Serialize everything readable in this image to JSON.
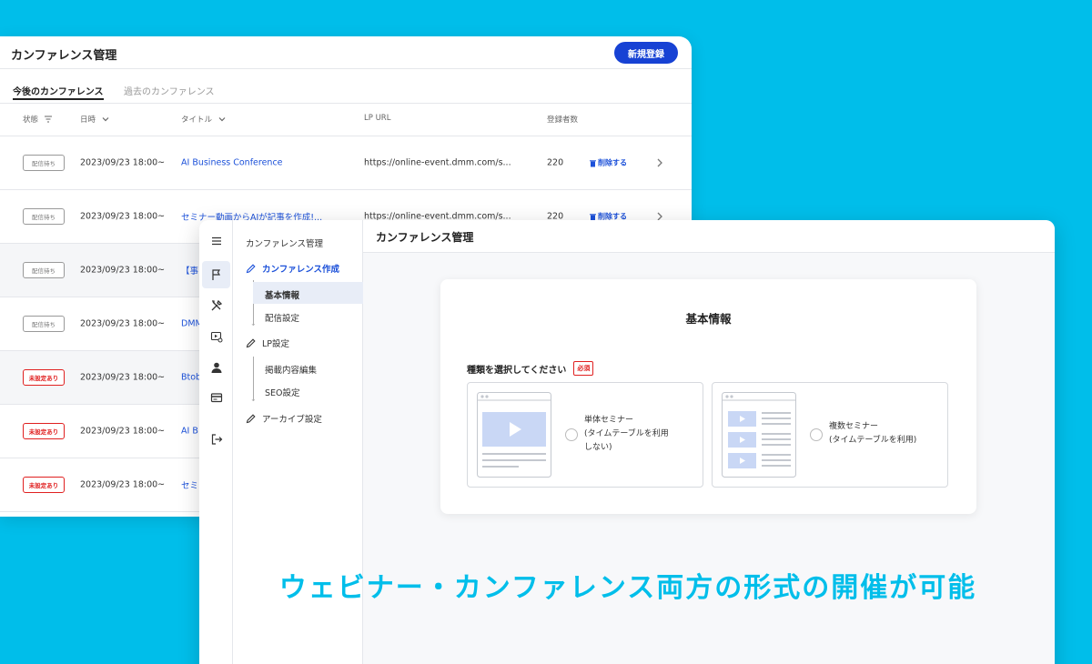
{
  "colors": {
    "background": "#00BEEA",
    "accent": "#1742D4",
    "link": "#1b50d9",
    "danger": "#E02020"
  },
  "back_window": {
    "title": "カンファレンス管理",
    "new_button": "新規登録",
    "tabs": [
      {
        "label": "今後のカンファレンス",
        "active": true
      },
      {
        "label": "過去のカンファレンス",
        "active": false
      }
    ],
    "columns": {
      "status": "状態",
      "date": "日時",
      "title": "タイトル",
      "lp_url": "LP URL",
      "registrants": "登録者数"
    },
    "rows": [
      {
        "status": "配信待ち",
        "date": "2023/09/23 18:00~",
        "title": "AI Business  Conference",
        "url": "https://online-event.dmm.com/s...",
        "count": "220",
        "action": "削除する"
      },
      {
        "status": "配信待ち",
        "date": "2023/09/23 18:00~",
        "title": "セミナー動画からAIが記事を作成!...",
        "url": "https://online-event.dmm.com/s...",
        "count": "220",
        "action": "削除する"
      },
      {
        "status": "配信待ち",
        "date": "2023/09/23 18:00~",
        "title": "【事",
        "url": "",
        "count": "",
        "action": ""
      },
      {
        "status": "配信待ち",
        "date": "2023/09/23 18:00~",
        "title": "DMM",
        "url": "",
        "count": "",
        "action": ""
      },
      {
        "status": "未設定あり",
        "date": "2023/09/23 18:00~",
        "title": "Btob",
        "url": "",
        "count": "",
        "action": ""
      },
      {
        "status": "未設定あり",
        "date": "2023/09/23 18:00~",
        "title": "AI B",
        "url": "",
        "count": "",
        "action": ""
      },
      {
        "status": "未設定あり",
        "date": "2023/09/23 18:00~",
        "title": "セミ",
        "url": "",
        "count": "",
        "action": ""
      }
    ]
  },
  "front_window": {
    "icon_bar": [
      "menu-icon",
      "flag-icon",
      "tools-icon",
      "video-settings-icon",
      "user-icon",
      "card-icon",
      "logout-icon"
    ],
    "nav": {
      "heading": "カンファレンス管理",
      "create": "カンファレンス作成",
      "basic_info": "基本情報",
      "delivery": "配信設定",
      "lp": "LP設定",
      "content_edit": "掲載内容編集",
      "seo": "SEO設定",
      "archive": "アーカイブ設定"
    },
    "main_title": "カンファレンス管理",
    "card": {
      "title": "基本情報",
      "label": "種類を選択してください",
      "required": "必須",
      "option_single_line1": "単体セミナー",
      "option_single_line2": "(タイムテーブルを利用",
      "option_single_line3": "しない)",
      "option_multi_line1": "複数セミナー",
      "option_multi_line2": "(タイムテーブルを利用)"
    }
  },
  "tagline": "ウェビナー・カンファレンス両方の形式の開催が可能"
}
